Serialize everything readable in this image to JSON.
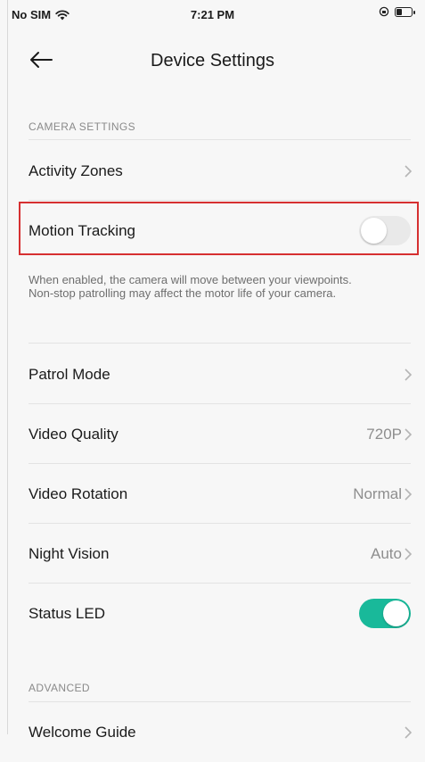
{
  "status_bar": {
    "carrier": "No SIM",
    "time": "7:21 PM"
  },
  "header": {
    "title": "Device Settings",
    "back_icon": "arrow-left-icon"
  },
  "sections": {
    "camera_settings": {
      "header": "CAMERA SETTINGS",
      "rows": {
        "activity_zones": {
          "label": "Activity Zones"
        },
        "motion_tracking": {
          "label": "Motion Tracking",
          "enabled": false
        },
        "motion_tracking_description": "When enabled, the camera will move between your viewpoints. Non-stop patrolling may affect the motor life of your camera.",
        "patrol_mode": {
          "label": "Patrol Mode"
        },
        "video_quality": {
          "label": "Video Quality",
          "value": "720P"
        },
        "video_rotation": {
          "label": "Video Rotation",
          "value": "Normal"
        },
        "night_vision": {
          "label": "Night Vision",
          "value": "Auto"
        },
        "status_led": {
          "label": "Status LED",
          "enabled": true
        }
      }
    },
    "advanced": {
      "header": "ADVANCED",
      "rows": {
        "welcome_guide": {
          "label": "Welcome Guide"
        }
      }
    }
  },
  "colors": {
    "accent": "#19b99a",
    "highlight": "#d63031",
    "background": "#f7f7f7"
  }
}
